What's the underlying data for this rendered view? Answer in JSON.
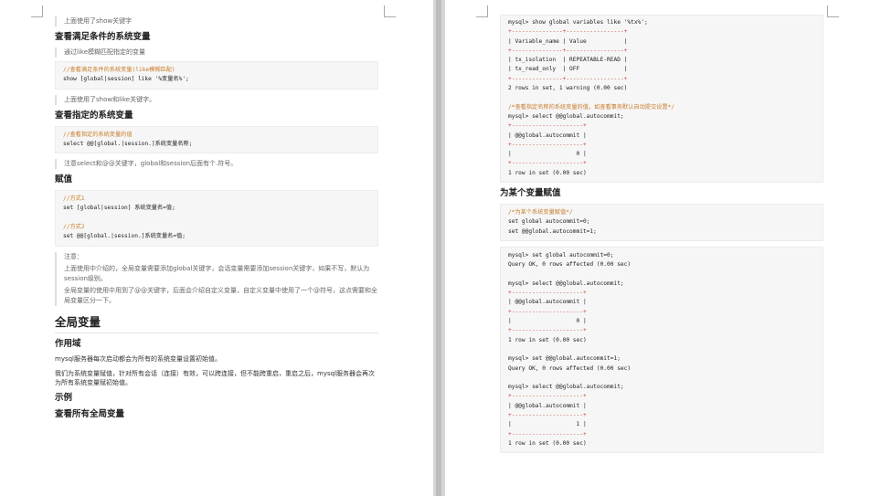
{
  "left": {
    "q1": "上面使用了show关键字",
    "h_cond": "查看满足条件的系统变量",
    "q2": "通过like模糊匹配指定的变量",
    "code1": [
      "//查看满足条件的系统变量(like模糊匹配)",
      "show [global|session] like '%变量名%';"
    ],
    "q3": "上面使用了show和like关键字。",
    "h_spec": "查看指定的系统变量",
    "code2": [
      "//查看指定的系统变量的值",
      "select @@[global.|session.]系统变量名称;"
    ],
    "q4": "注意select和@@关键字，global和session后面有个.符号。",
    "h_assign": "赋值",
    "code3": [
      "//方式1",
      "set [global|session] 系统变量名=值;",
      "",
      "//方式2",
      "set @@[global.|session.]系统变量名=值;"
    ],
    "note_title": "注意：",
    "note_p1": "上面使用中介绍的，全局变量需要添加global关键字，会话变量需要添加session关键字，如果不写，默认为session级别。",
    "note_p2": "全局变量的使用中用到了@@关键字，后面会介绍自定义变量，自定义变量中使用了一个@符号，这点需要和全局变量区分一下。",
    "h_global": "全局变量",
    "h_scope": "作用域",
    "p_scope1": "mysql服务器每次启动都会为所有的系统变量设置初始值。",
    "p_scope2": "我们为系统变量赋值，针对所有会话（连接）有效，可以跨连接，但不能跨重启，重启之后，mysql服务器会再次为所有系统变量赋初始值。",
    "h_example": "示例",
    "h_view_all": "查看所有全局变量"
  },
  "right": {
    "code_show": [
      "mysql> show global variables like '%tx%';",
      "+---------------+-----------------+",
      "| Variable_name | Value           |",
      "+---------------+-----------------+",
      "| tx_isolation  | REPEATABLE-READ |",
      "| tx_read_only  | OFF             |",
      "+---------------+-----------------+",
      "2 rows in set, 1 warning (0.00 sec)",
      "",
      "/*查看指定名称的系统变量的值，如查看事务默认自动提交设置*/",
      "mysql> select @@global.autocommit;",
      "+---------------------+",
      "| @@global.autocommit |",
      "+---------------------+",
      "|                   0 |",
      "+---------------------+",
      "1 row in set (0.00 sec)"
    ],
    "h_assign_one": "为某个变量赋值",
    "code_assign": [
      "/*为某个系统变量赋值*/",
      "set global autocommit=0;",
      "set @@global.autocommit=1;"
    ],
    "code_run": [
      "mysql> set global autocommit=0;",
      "Query OK, 0 rows affected (0.00 sec)",
      "",
      "mysql> select @@global.autocommit;",
      "+---------------------+",
      "| @@global.autocommit |",
      "+---------------------+",
      "|                   0 |",
      "+---------------------+",
      "1 row in set (0.00 sec)",
      "",
      "mysql> set @@global.autocommit=1;",
      "Query OK, 0 rows affected (0.00 sec)",
      "",
      "mysql> select @@global.autocommit;",
      "+---------------------+",
      "| @@global.autocommit |",
      "+---------------------+",
      "|                   1 |",
      "+---------------------+",
      "1 row in set (0.00 sec)"
    ]
  }
}
